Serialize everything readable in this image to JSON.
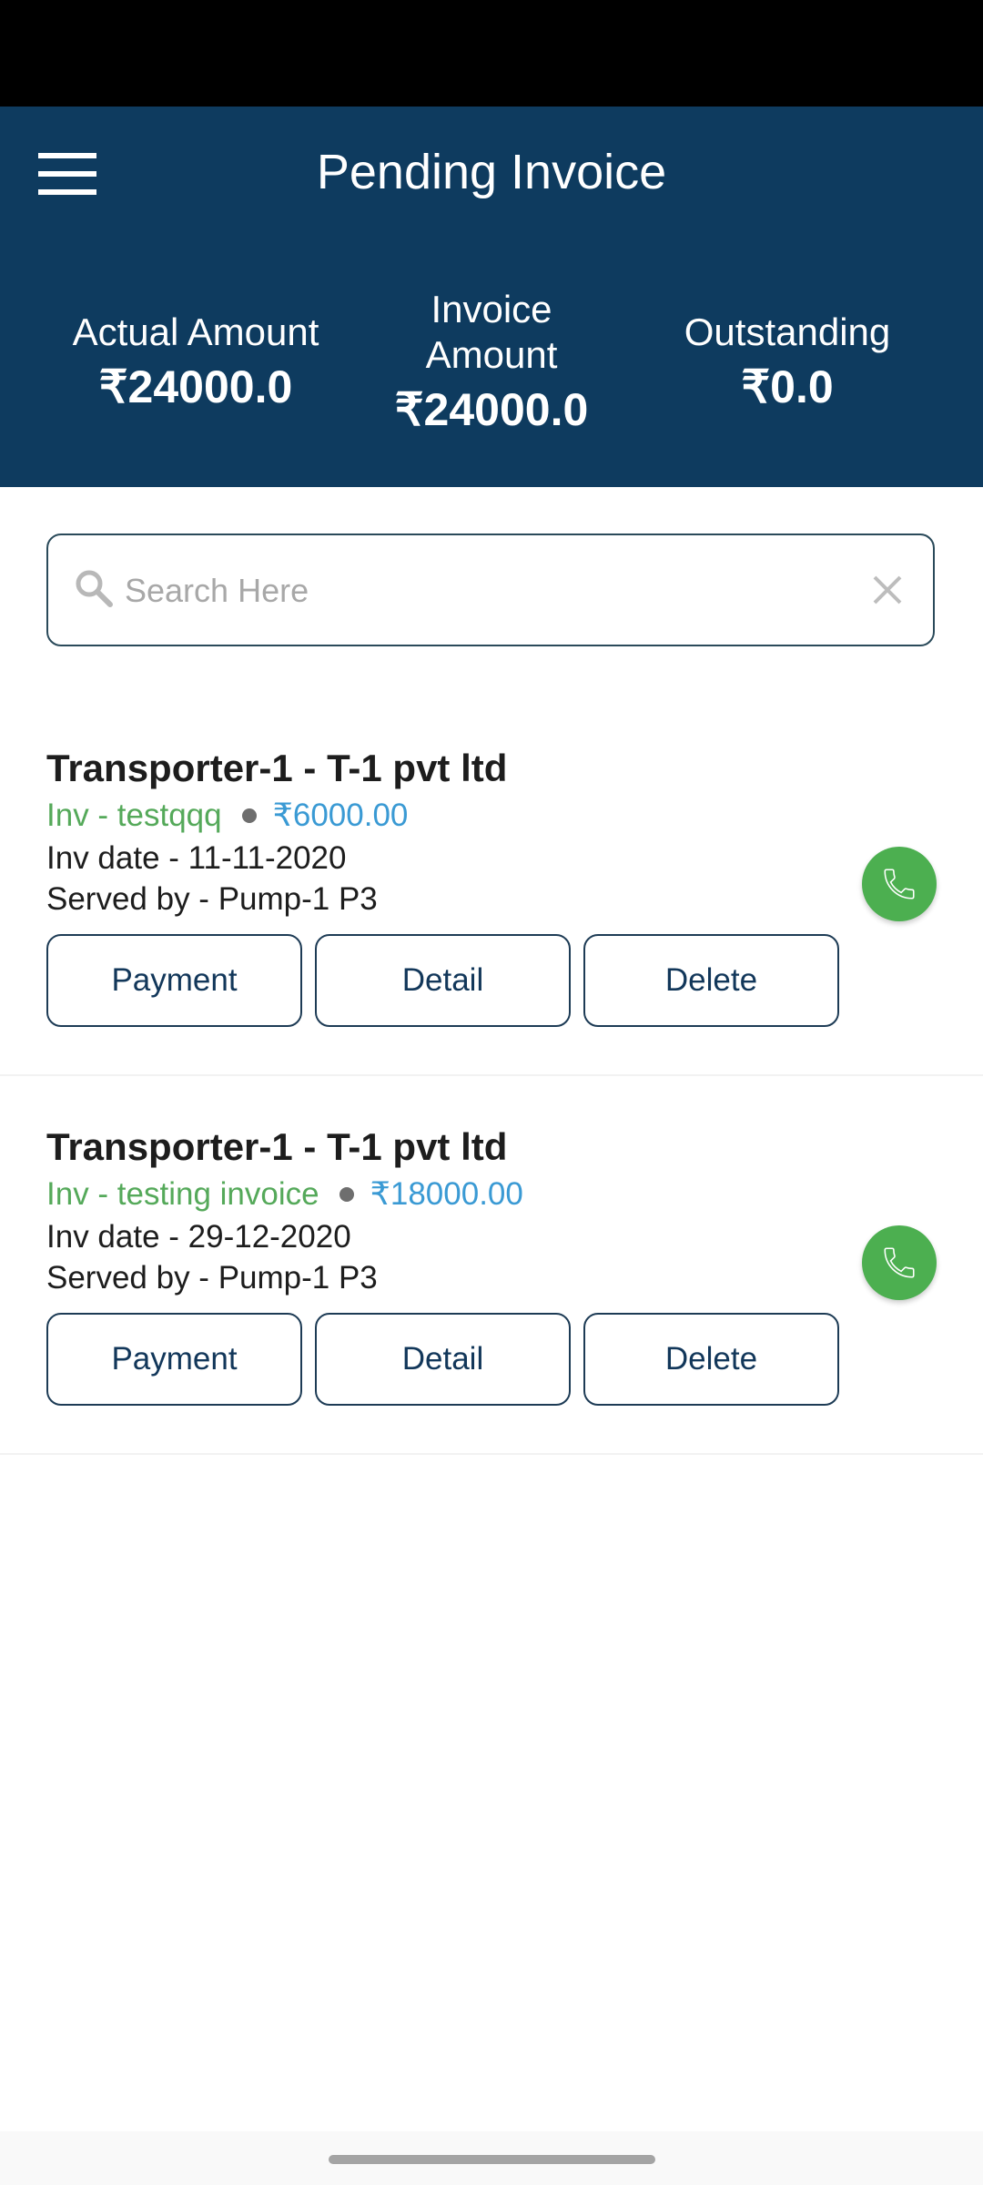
{
  "header": {
    "title": "Pending Invoice",
    "stats": {
      "actual": {
        "label": "Actual Amount",
        "value": "₹24000.0"
      },
      "invoice": {
        "label_line1": "Invoice",
        "label_line2": "Amount",
        "value": "₹24000.0"
      },
      "outstanding": {
        "label": "Outstanding",
        "value": "₹0.0"
      }
    }
  },
  "search": {
    "placeholder": "Search Here",
    "value": ""
  },
  "invoices": [
    {
      "name": "Transporter-1 - T-1 pvt ltd",
      "inv": "Inv - testqqq",
      "amount": "₹6000.00",
      "date": "Inv date - 11-11-2020",
      "served_by": "Served by - Pump-1 P3"
    },
    {
      "name": "Transporter-1 - T-1 pvt ltd",
      "inv": "Inv - testing invoice",
      "amount": "₹18000.00",
      "date": "Inv date - 29-12-2020",
      "served_by": "Served by - Pump-1 P3"
    }
  ],
  "buttons": {
    "payment": "Payment",
    "detail": "Detail",
    "delete": "Delete"
  },
  "colors": {
    "header_bg": "#0e3b5f",
    "inv_green": "#55a95a",
    "amount_blue": "#3a9ad4",
    "call_green": "#4caf50"
  }
}
